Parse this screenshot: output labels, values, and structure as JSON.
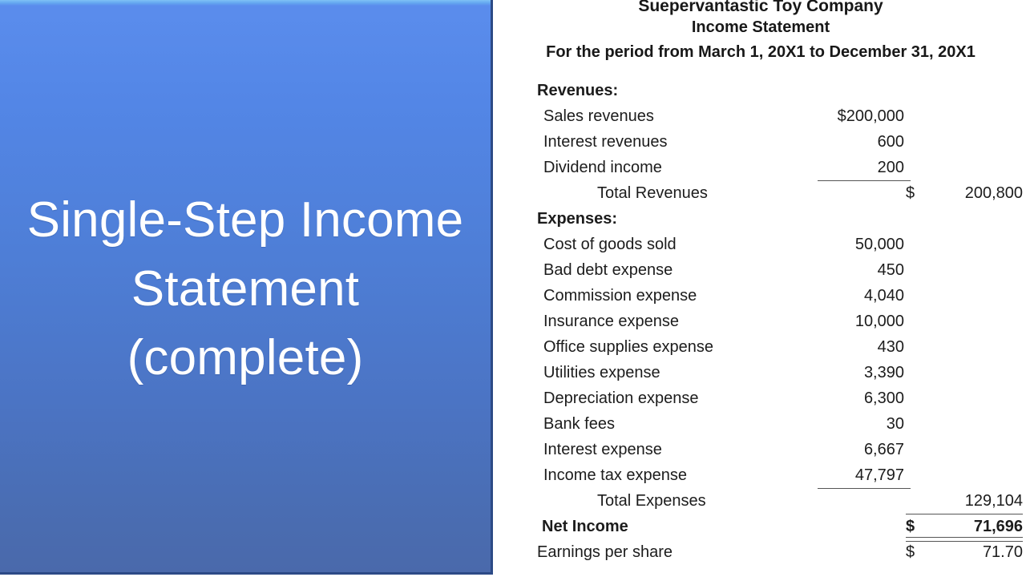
{
  "slide": {
    "title": "Single-Step Income Statement (complete)",
    "accent_color": "#5386e6",
    "border_color": "#2c4a86"
  },
  "statement": {
    "company": "Suepervantastic Toy Company",
    "document_title": "Income Statement",
    "period": "For the period from March 1, 20X1  to December 31, 20X1",
    "rows": [
      {
        "type": "section",
        "label": "Revenues:",
        "col1": "",
        "sym2": "",
        "col2": ""
      },
      {
        "type": "item",
        "label": "Sales revenues",
        "col1": "$200,000",
        "sym2": "",
        "col2": ""
      },
      {
        "type": "item",
        "label": "Interest revenues",
        "col1": "600",
        "sym2": "",
        "col2": ""
      },
      {
        "type": "item",
        "label": "Dividend income",
        "col1": "200",
        "sym2": "",
        "col2": "",
        "rule": "col1"
      },
      {
        "type": "subtotal",
        "label": "Total Revenues",
        "col1": "",
        "sym2": "$",
        "col2": "200,800"
      },
      {
        "type": "section",
        "label": "Expenses:",
        "col1": "",
        "sym2": "",
        "col2": ""
      },
      {
        "type": "item",
        "label": "Cost of goods sold",
        "col1": "50,000",
        "sym2": "",
        "col2": ""
      },
      {
        "type": "item",
        "label": "Bad debt expense",
        "col1": "450",
        "sym2": "",
        "col2": ""
      },
      {
        "type": "item",
        "label": "Commission expense",
        "col1": "4,040",
        "sym2": "",
        "col2": ""
      },
      {
        "type": "item",
        "label": "Insurance expense",
        "col1": "10,000",
        "sym2": "",
        "col2": ""
      },
      {
        "type": "item",
        "label": "Office supplies expense",
        "col1": "430",
        "sym2": "",
        "col2": ""
      },
      {
        "type": "item",
        "label": "Utilities expense",
        "col1": "3,390",
        "sym2": "",
        "col2": ""
      },
      {
        "type": "item",
        "label": "Depreciation expense",
        "col1": "6,300",
        "sym2": "",
        "col2": ""
      },
      {
        "type": "item",
        "label": "Bank fees",
        "col1": "30",
        "sym2": "",
        "col2": ""
      },
      {
        "type": "item",
        "label": "Interest expense",
        "col1": "6,667",
        "sym2": "",
        "col2": ""
      },
      {
        "type": "item",
        "label": "Income tax expense",
        "col1": "47,797",
        "sym2": "",
        "col2": "",
        "rule": "col1"
      },
      {
        "type": "subtotal",
        "label": "Total Expenses",
        "col1": "",
        "sym2": "",
        "col2": "129,104",
        "rule": "col2"
      },
      {
        "type": "netincome",
        "label": "Net Income",
        "col1": "",
        "sym2": "$",
        "col2": "71,696",
        "bold_amount": true,
        "rule": "col2-double"
      },
      {
        "type": "eps",
        "label": "Earnings per share",
        "col1": "",
        "sym2": "$",
        "col2": "71.70"
      }
    ]
  }
}
